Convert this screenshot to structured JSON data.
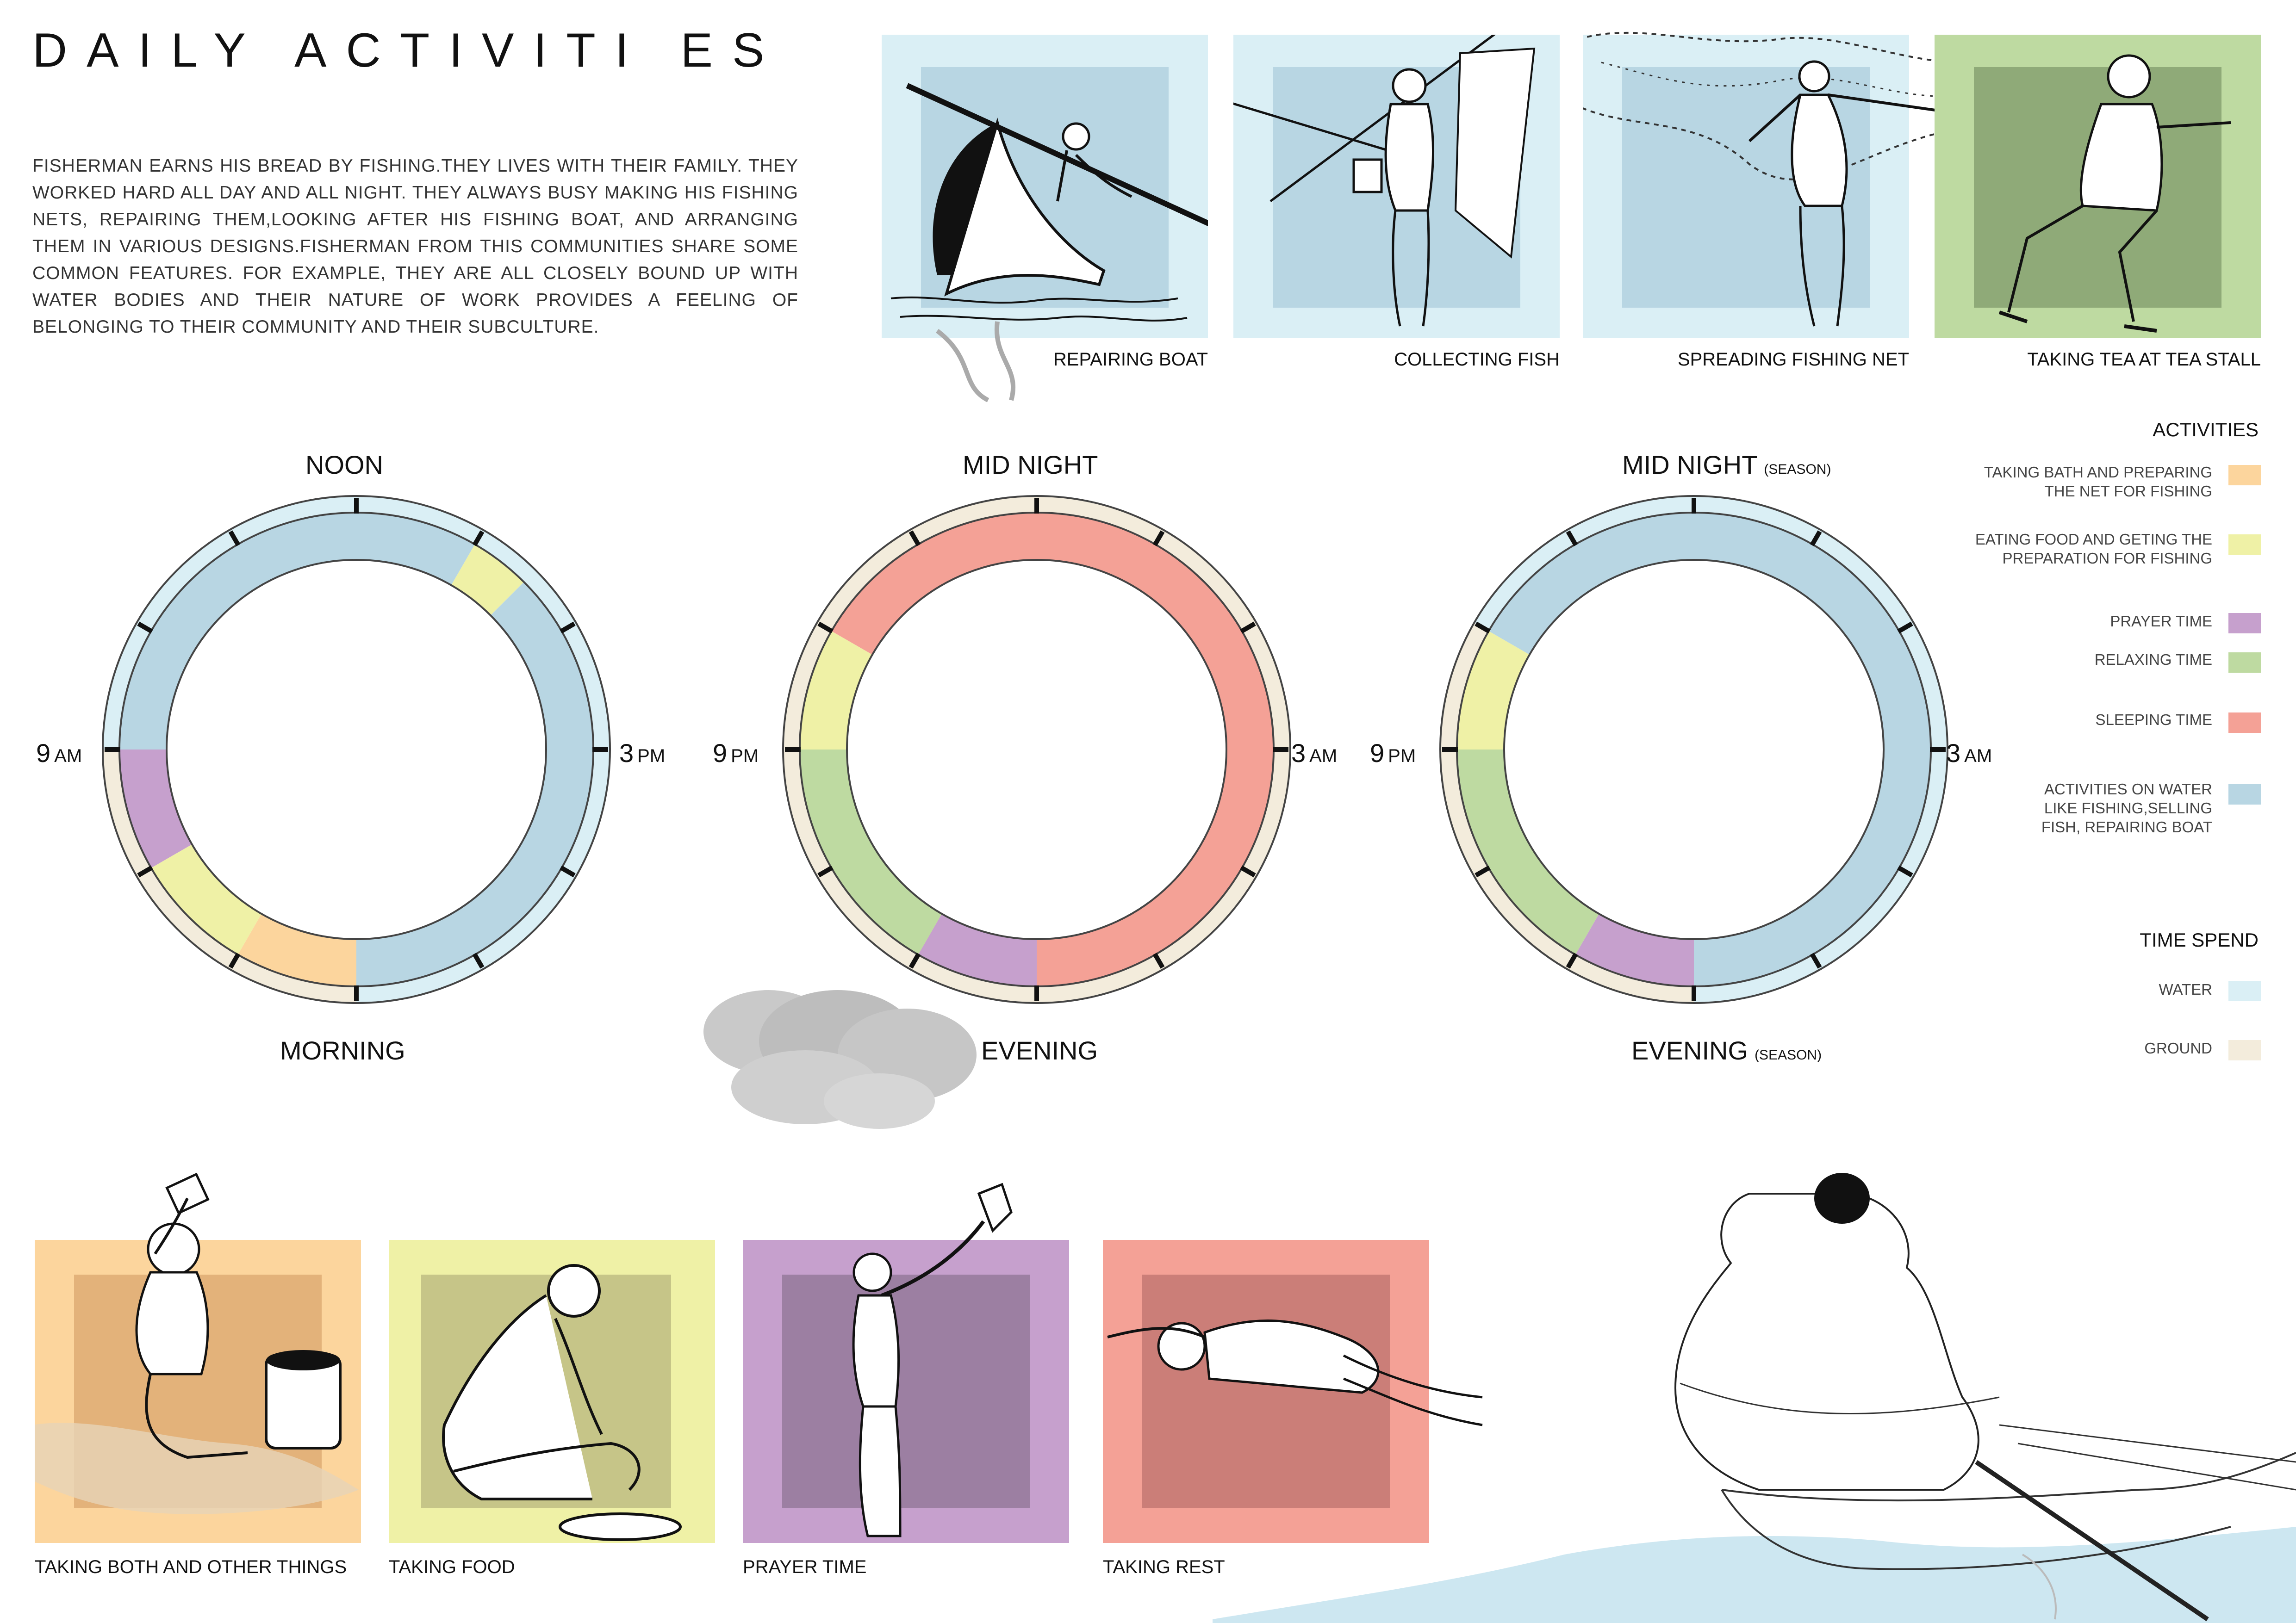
{
  "title": "DAILY ACTIVITI ES",
  "intro": "FISHERMAN EARNS HIS BREAD BY FISHING.THEY LIVES WITH THEIR FAMILY. THEY WORKED HARD ALL DAY AND ALL NIGHT. THEY ALWAYS BUSY MAKING HIS FISHING NETS, REPAIRING THEM,LOOKING AFTER HIS FISHING BOAT, AND ARRANGING THEM IN VARIOUS DESIGNS.FISHERMAN FROM THIS  COMMUNITIES SHARE SOME COMMON FEATURES. FOR EXAMPLE, THEY ARE ALL CLOSELY BOUND UP WITH WATER BODIES AND THEIR NATURE OF WORK PROVIDES A FEELING OF BELONGING TO THEIR COMMUNITY AND THEIR SUBCULTURE.",
  "top_panels": [
    {
      "caption": "REPAIRING BOAT",
      "icon": "boat-repair-illustration",
      "color": "#b8d6e3",
      "frame": "#daeff5"
    },
    {
      "caption": "COLLECTING FISH",
      "icon": "fish-collecting-illustration",
      "color": "#b8d6e3",
      "frame": "#daeff5"
    },
    {
      "caption": "SPREADING FISHING NET",
      "icon": "net-spreading-illustration",
      "color": "#b8d6e3",
      "frame": "#daeff5"
    },
    {
      "caption": "TAKING TEA AT TEA STALL",
      "icon": "tea-stall-illustration",
      "color": "#8faa78",
      "frame": "#bedaa1"
    }
  ],
  "bottom_panels": [
    {
      "caption": "TAKING BOTH AND OTHER THINGS",
      "icon": "bathing-illustration",
      "color": "#e3b27a",
      "frame": "#fcd59d"
    },
    {
      "caption": "TAKING FOOD",
      "icon": "eating-illustration",
      "color": "#c6c588",
      "frame": "#eff1a6"
    },
    {
      "caption": "PRAYER TIME",
      "icon": "prayer-illustration",
      "color": "#9c7fa2",
      "frame": "#c6a0cd"
    },
    {
      "caption": "TAKING REST",
      "icon": "resting-illustration",
      "color": "#cb7e78",
      "frame": "#f4a196"
    }
  ],
  "clocks": [
    {
      "top": "NOON",
      "top_note": "",
      "bottom": "MORNING",
      "bottom_note": "",
      "left": "9",
      "left_unit": "AM",
      "right": "3",
      "right_unit": "PM",
      "outer": [
        {
          "type": "water",
          "from": 0,
          "to": 90
        },
        {
          "type": "water",
          "from": 90,
          "to": 180
        },
        {
          "type": "ground",
          "from": 180,
          "to": 270
        },
        {
          "type": "water",
          "from": 270,
          "to": 360
        }
      ],
      "inner": [
        {
          "activity": "water_activities",
          "from": 0,
          "to": 30
        },
        {
          "activity": "eating",
          "from": 30,
          "to": 45
        },
        {
          "activity": "water_activities",
          "from": 45,
          "to": 180
        },
        {
          "activity": "bathing",
          "from": 180,
          "to": 210
        },
        {
          "activity": "eating",
          "from": 210,
          "to": 240
        },
        {
          "activity": "prayer",
          "from": 240,
          "to": 270
        },
        {
          "activity": "water_activities",
          "from": 270,
          "to": 360
        }
      ]
    },
    {
      "top": "MID NIGHT",
      "top_note": "",
      "bottom": "EVENING",
      "bottom_note": "",
      "left": "9",
      "left_unit": "PM",
      "right": "3",
      "right_unit": "AM",
      "outer": [
        {
          "type": "ground",
          "from": 0,
          "to": 360
        }
      ],
      "inner": [
        {
          "activity": "sleeping",
          "from": 0,
          "to": 210
        },
        {
          "activity": "prayer",
          "from": 180,
          "to": 210
        },
        {
          "activity": "relaxing",
          "from": 210,
          "to": 270
        },
        {
          "activity": "eating",
          "from": 270,
          "to": 300
        },
        {
          "activity": "sleeping",
          "from": 300,
          "to": 360
        }
      ]
    },
    {
      "top": "MID NIGHT",
      "top_note": "(SEASON)",
      "bottom": "EVENING",
      "bottom_note": "(SEASON)",
      "left": "9",
      "left_unit": "PM",
      "right": "3",
      "right_unit": "AM",
      "outer": [
        {
          "type": "water",
          "from": 0,
          "to": 90
        },
        {
          "type": "water",
          "from": 90,
          "to": 180
        },
        {
          "type": "ground",
          "from": 180,
          "to": 300
        },
        {
          "type": "water",
          "from": 300,
          "to": 360
        }
      ],
      "inner": [
        {
          "activity": "water_activities",
          "from": 0,
          "to": 180
        },
        {
          "activity": "prayer",
          "from": 180,
          "to": 210
        },
        {
          "activity": "relaxing",
          "from": 210,
          "to": 270
        },
        {
          "activity": "eating",
          "from": 270,
          "to": 300
        },
        {
          "activity": "water_activities",
          "from": 300,
          "to": 360
        }
      ]
    }
  ],
  "legend": {
    "heading": "ACTIVITIES",
    "items": [
      {
        "key": "bathing",
        "label": "TAKING BATH AND PREPARING THE NET FOR FISHING",
        "color": "#fcd59d"
      },
      {
        "key": "eating",
        "label": "EATING FOOD AND GETING THE  PREPARATION FOR FISHING",
        "color": "#eff1a6"
      },
      {
        "key": "prayer",
        "label": "PRAYER TIME",
        "color": "#c6a0cd"
      },
      {
        "key": "relaxing",
        "label": "RELAXING TIME",
        "color": "#bedaa1"
      },
      {
        "key": "sleeping",
        "label": "SLEEPING TIME",
        "color": "#f4a196"
      },
      {
        "key": "water_activities",
        "label": "ACTIVITIES ON WATER LIKE FISHING,SELLING FISH, REPAIRING BOAT",
        "color": "#b8d6e3"
      }
    ],
    "time_heading": "TIME SPEND",
    "time_items": [
      {
        "key": "water",
        "label": "WATER",
        "color": "#daeff5"
      },
      {
        "key": "ground",
        "label": "GROUND",
        "color": "#f3ecdc"
      }
    ]
  }
}
